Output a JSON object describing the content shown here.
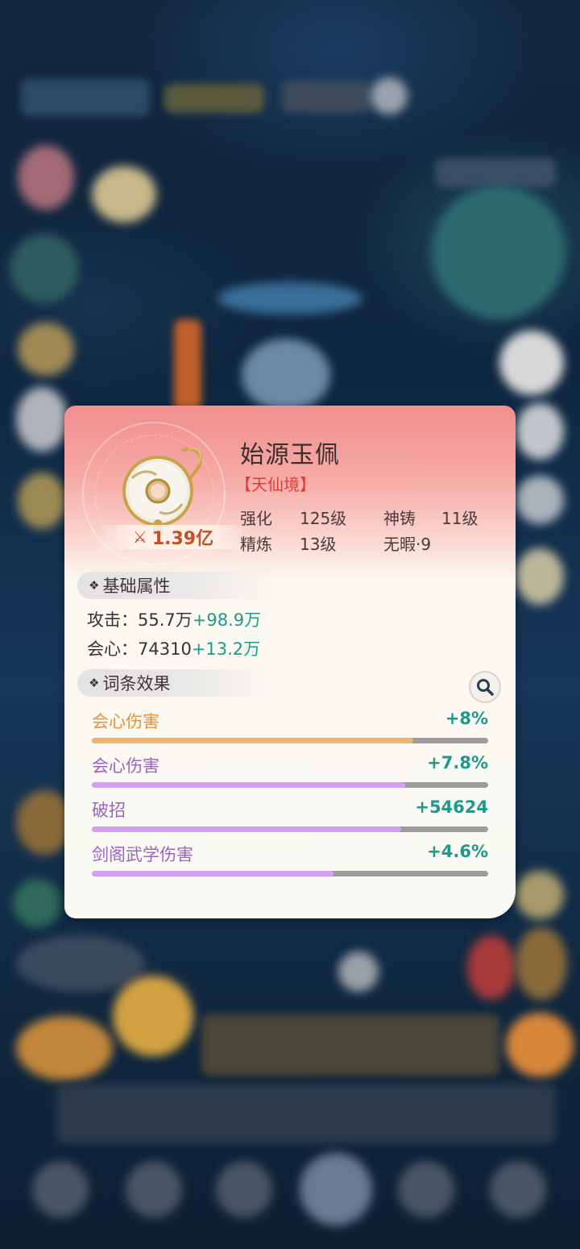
{
  "item": {
    "name": "始源玉佩",
    "realm": "【天仙境】",
    "power": "1.39亿",
    "stats": {
      "qianghua_label": "强化",
      "qianghua_value": "125级",
      "shenzhu_label": "神铸",
      "shenzhu_value": "11级",
      "jinglian_label": "精炼",
      "jinglian_value": "13级",
      "wuxia_label": "无暇",
      "wuxia_value": "9"
    }
  },
  "base_attributes": {
    "header": "基础属性",
    "rows": [
      {
        "label": "攻击：",
        "value": "55.7万",
        "bonus": "+98.9万"
      },
      {
        "label": "会心：",
        "value": "74310",
        "bonus": "+13.2万"
      }
    ]
  },
  "affixes": {
    "header": "词条效果",
    "items": [
      {
        "name": "会心伤害",
        "value": "+8%",
        "fill": 0.81,
        "color": "#f0b46a",
        "name_color": "#e8913a"
      },
      {
        "name": "会心伤害",
        "value": "+7.8%",
        "fill": 0.79,
        "color": "#d6a0f0",
        "name_color": "#9a62c8"
      },
      {
        "name": "破招",
        "value": "+54624",
        "fill": 0.78,
        "color": "#d6a0f0",
        "name_color": "#9a62c8"
      },
      {
        "name": "剑阁武学伤害",
        "value": "+4.6%",
        "fill": 0.61,
        "color": "#d6a0f0",
        "name_color": "#9a62c8"
      }
    ]
  },
  "icons": {
    "search": "search-icon",
    "power": "crossed-swords-icon",
    "item": "jade-pendant-icon"
  }
}
